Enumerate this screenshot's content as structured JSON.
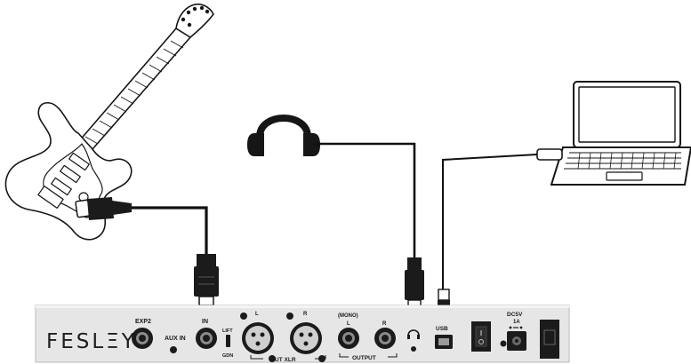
{
  "brand": "FESLΞY",
  "panel": {
    "exp_label": "EXP2",
    "aux_in_label": "AUX IN",
    "in_label": "IN",
    "lift_label": "LIFT",
    "gnd_label": "GDN",
    "xlr_l_label": "L",
    "xlr_r_label": "R",
    "out_xlr_label": "OUT XLR",
    "mono_label": "(MONO)",
    "out_l_label": "L",
    "out_r_label": "R",
    "output_label": "OUTPUT",
    "usb_label": "USB",
    "dc_label": "DC5V",
    "dc_current_label": "1A"
  },
  "colors": {
    "panel": "#e6e6e6",
    "panel_edge": "#b9b9b9",
    "jack_dark": "#1b1b1b",
    "cable": "#111111",
    "outline": "#161616"
  },
  "icons": [
    "guitar-icon",
    "headphones-icon",
    "laptop-icon",
    "headphone-symbol-icon"
  ]
}
